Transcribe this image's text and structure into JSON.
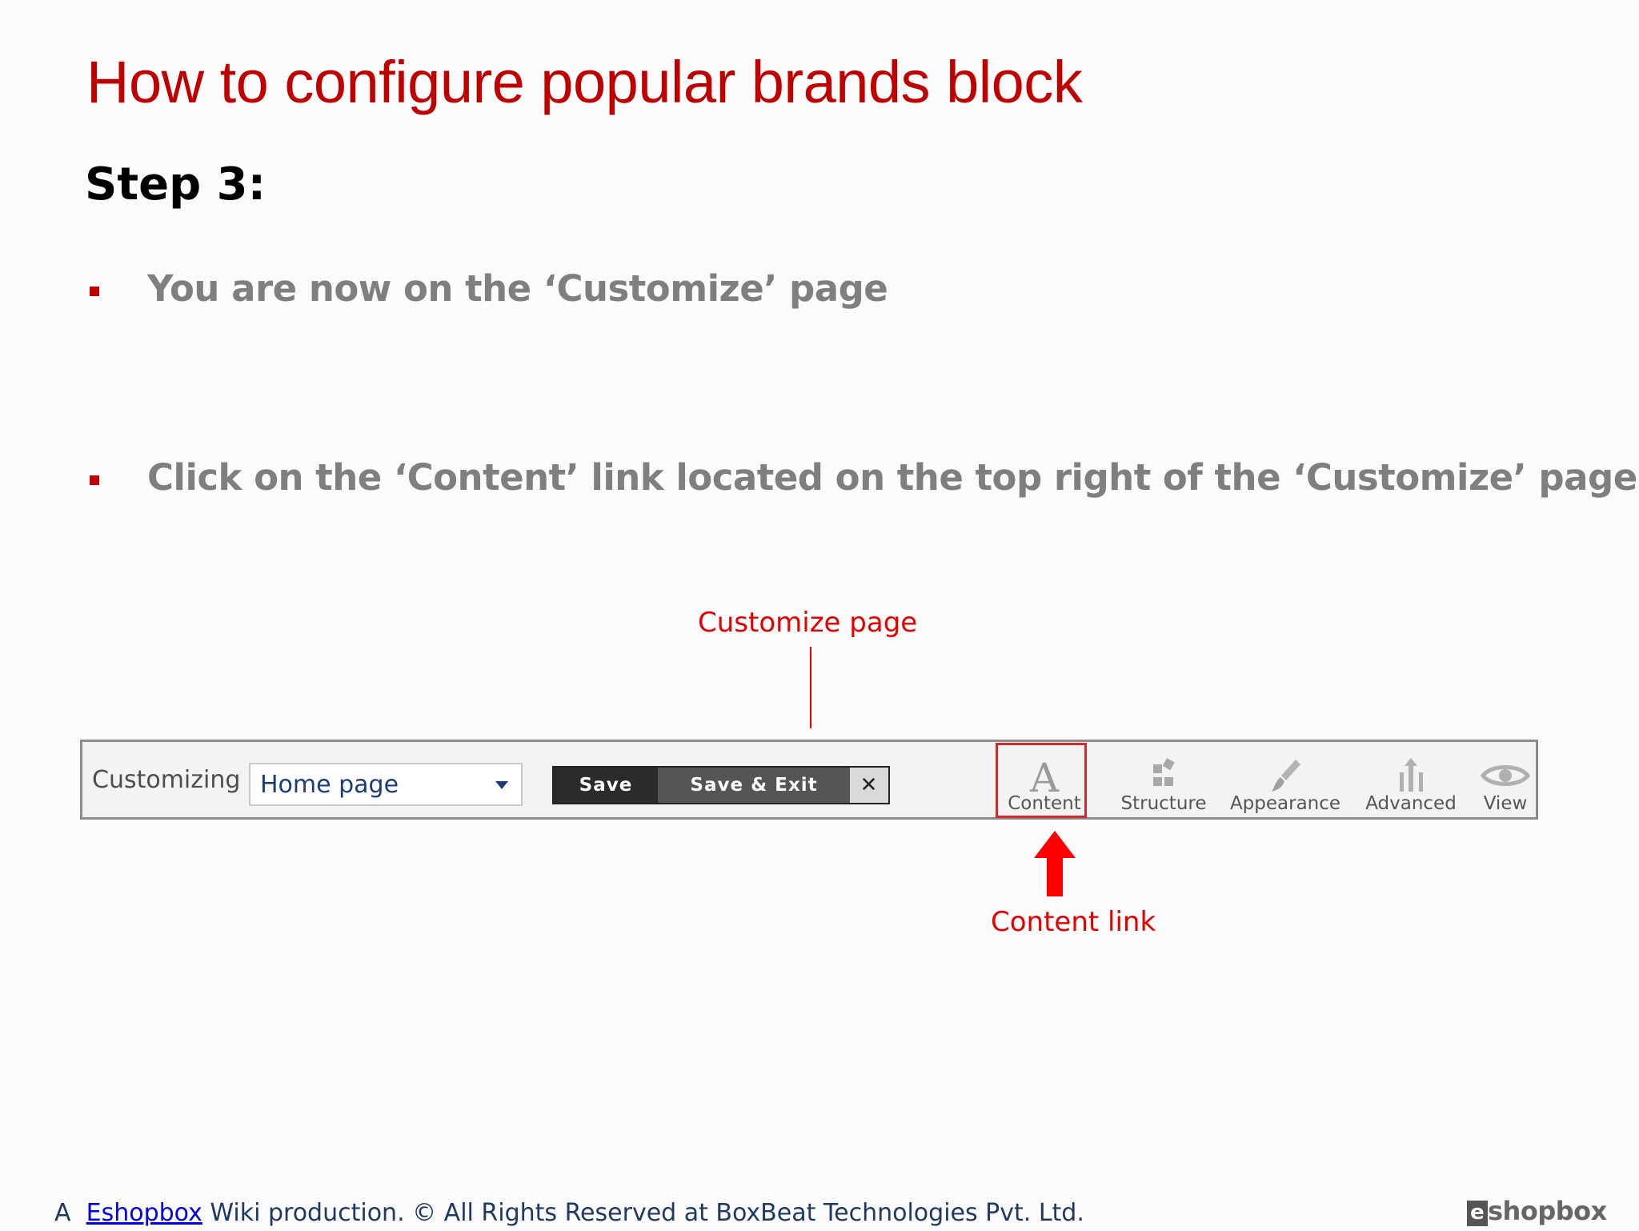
{
  "slide": {
    "title": "How to configure popular brands block",
    "step_heading": "Step 3:",
    "bullets": [
      "You are now on the ‘Customize’ page",
      "Click on the ‘Content’ link located on the top right of the ‘Customize’ page"
    ]
  },
  "annotations": {
    "customize_page": "Customize page",
    "content_link": "Content link"
  },
  "toolbar": {
    "customizing_label": "Customizing",
    "page_select_value": "Home page",
    "save_label": "Save",
    "save_exit_label": "Save & Exit",
    "close_label": "✕",
    "tools": [
      {
        "label": "Content",
        "icon": "letter-a-icon"
      },
      {
        "label": "Structure",
        "icon": "blocks-icon"
      },
      {
        "label": "Appearance",
        "icon": "paintbrush-icon"
      },
      {
        "label": "Advanced",
        "icon": "advanced-icon"
      },
      {
        "label": "View",
        "icon": "eye-icon"
      }
    ]
  },
  "footer": {
    "prefix": "A",
    "link_text": "Eshopbox",
    "suffix": "Wiki production. © All Rights Reserved at BoxBeat Technologies Pvt. Ltd."
  },
  "logo": {
    "e_letter": "e",
    "word": "shopbox"
  },
  "colors": {
    "title_red": "#c00000",
    "annotation_red": "#e60000",
    "bullet_gray": "#7f7f7f"
  }
}
